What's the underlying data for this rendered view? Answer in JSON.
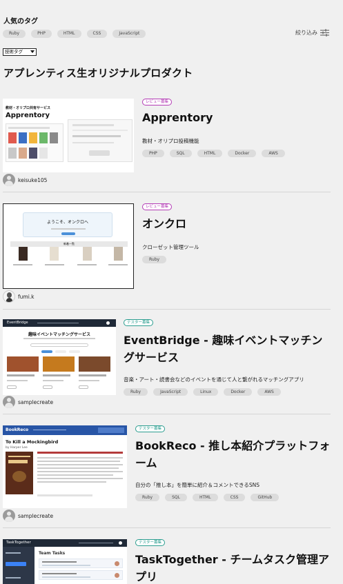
{
  "popular": {
    "title": "人気のタグ",
    "tags": [
      "Ruby",
      "PHP",
      "HTML",
      "CSS",
      "JavaScript"
    ],
    "filter_label": "絞り込み"
  },
  "tag_select": {
    "value": "技術タグ"
  },
  "section_title": "アプレンティス生オリジナルプロダクト",
  "products": [
    {
      "badge": "レビュー募集",
      "title": "Apprentory",
      "description": "教材・オリプロ投稿機能",
      "tags": [
        "PHP",
        "SQL",
        "HTML",
        "Docker",
        "AWS"
      ],
      "author": "keisuke105",
      "thumb": {
        "heading": "教材・オリプロ共有サービス",
        "brand": "Apprentory"
      }
    },
    {
      "badge": "レビュー募集",
      "title": "オンクロ",
      "description": "クローゼット管理ツール",
      "tags": [
        "Ruby"
      ],
      "author": "fumi.k",
      "thumb": {
        "heading": "ようこそ、オンクロへ",
        "section": "新着一覧"
      }
    },
    {
      "badge": "テスター募集",
      "title": "EventBridge - 趣味イベントマッチングサービス",
      "description": "音楽・アート・読書会などのイベントを通じて人と繋がれるマッチングアプリ",
      "tags": [
        "Ruby",
        "JavaScript",
        "Linux",
        "Docker",
        "AWS"
      ],
      "author": "samplecreate",
      "thumb": {
        "brand": "EventBridge",
        "heading": "趣味イベントマッチングサービス"
      }
    },
    {
      "badge": "テスター募集",
      "title": "BookReco - 推し本紹介プラットフォーム",
      "description": "自分の「推し本」を簡単に紹介＆コメントできるSNS",
      "tags": [
        "Ruby",
        "SQL",
        "HTML",
        "CSS",
        "GitHub"
      ],
      "author": "samplecreate",
      "thumb": {
        "brand": "BookReco",
        "book": "To Kill a Mockingbird",
        "book_author": "by Harper Lee"
      }
    },
    {
      "badge": "テスター募集",
      "title": "TaskTogether - チームタスク管理アプリ",
      "thumb": {
        "brand": "TaskTogether",
        "heading": "Team Tasks"
      }
    }
  ],
  "colors": {
    "review": "#b33ab5",
    "tester": "#2a9d8f",
    "chip": "#dcdcdc",
    "background": "#f0f0f0"
  }
}
